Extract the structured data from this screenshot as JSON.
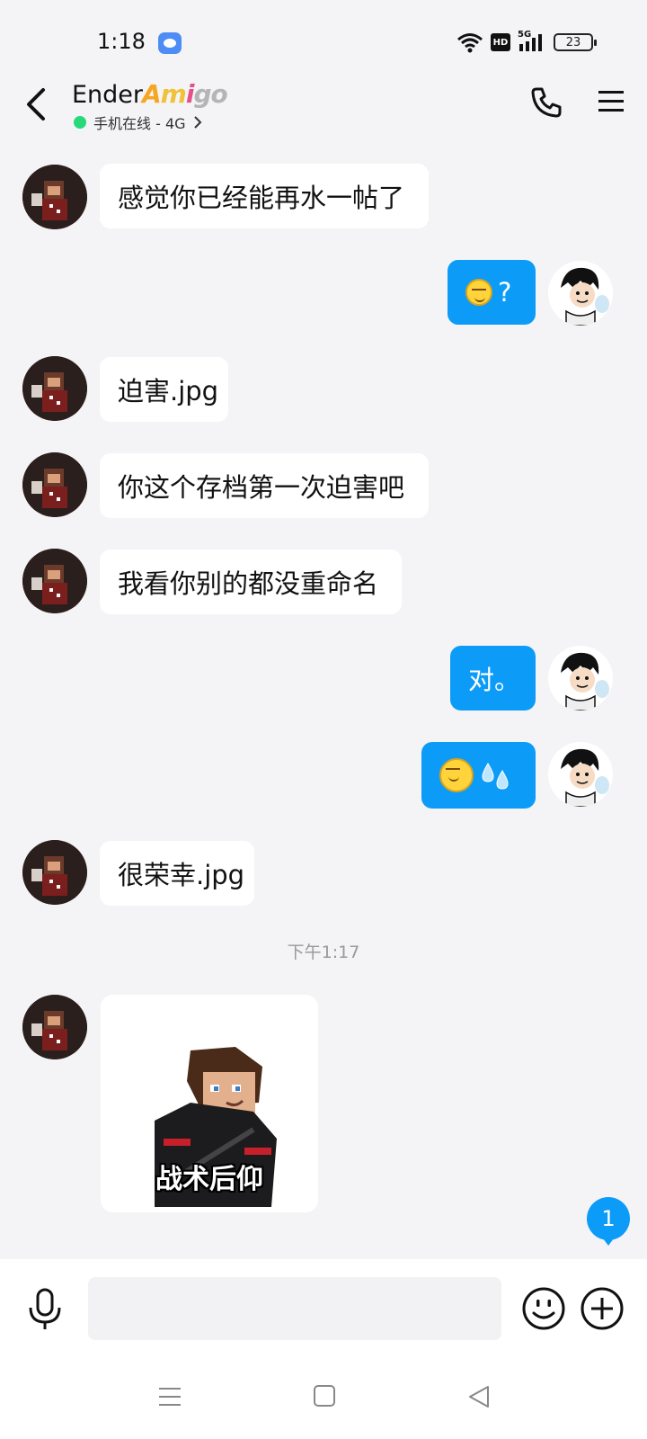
{
  "status_bar": {
    "time": "1:18",
    "network": "5G",
    "hd": "HD",
    "battery": "23"
  },
  "header": {
    "contact_name": "Ender",
    "badge_text": "Amigo",
    "online_status": "手机在线 - 4G",
    "icons": [
      "back-arrow-icon",
      "phone-icon",
      "menu-icon"
    ]
  },
  "messages": [
    {
      "side": "left",
      "text": "感觉你已经能再水一帖了"
    },
    {
      "side": "right",
      "emoji": "grinning-face",
      "text": "?"
    },
    {
      "side": "left",
      "text": "迫害.jpg"
    },
    {
      "side": "left",
      "text": "你这个存档第一次迫害吧"
    },
    {
      "side": "left",
      "text": "我看你别的都没重命名"
    },
    {
      "side": "right",
      "text": "对。"
    },
    {
      "side": "right",
      "emoji": "grinning-face + sweat-droplets",
      "text": ""
    },
    {
      "side": "left",
      "text": "很荣幸.jpg"
    }
  ],
  "timestamp": "下午1:17",
  "sticker": {
    "caption": "战术后仰"
  },
  "unread_count": "1",
  "input": {
    "placeholder": ""
  },
  "colors": {
    "background": "#f4f4f6",
    "bubble_self": "#0c9cf8",
    "bubble_other": "#ffffff",
    "online": "#27d97b"
  }
}
